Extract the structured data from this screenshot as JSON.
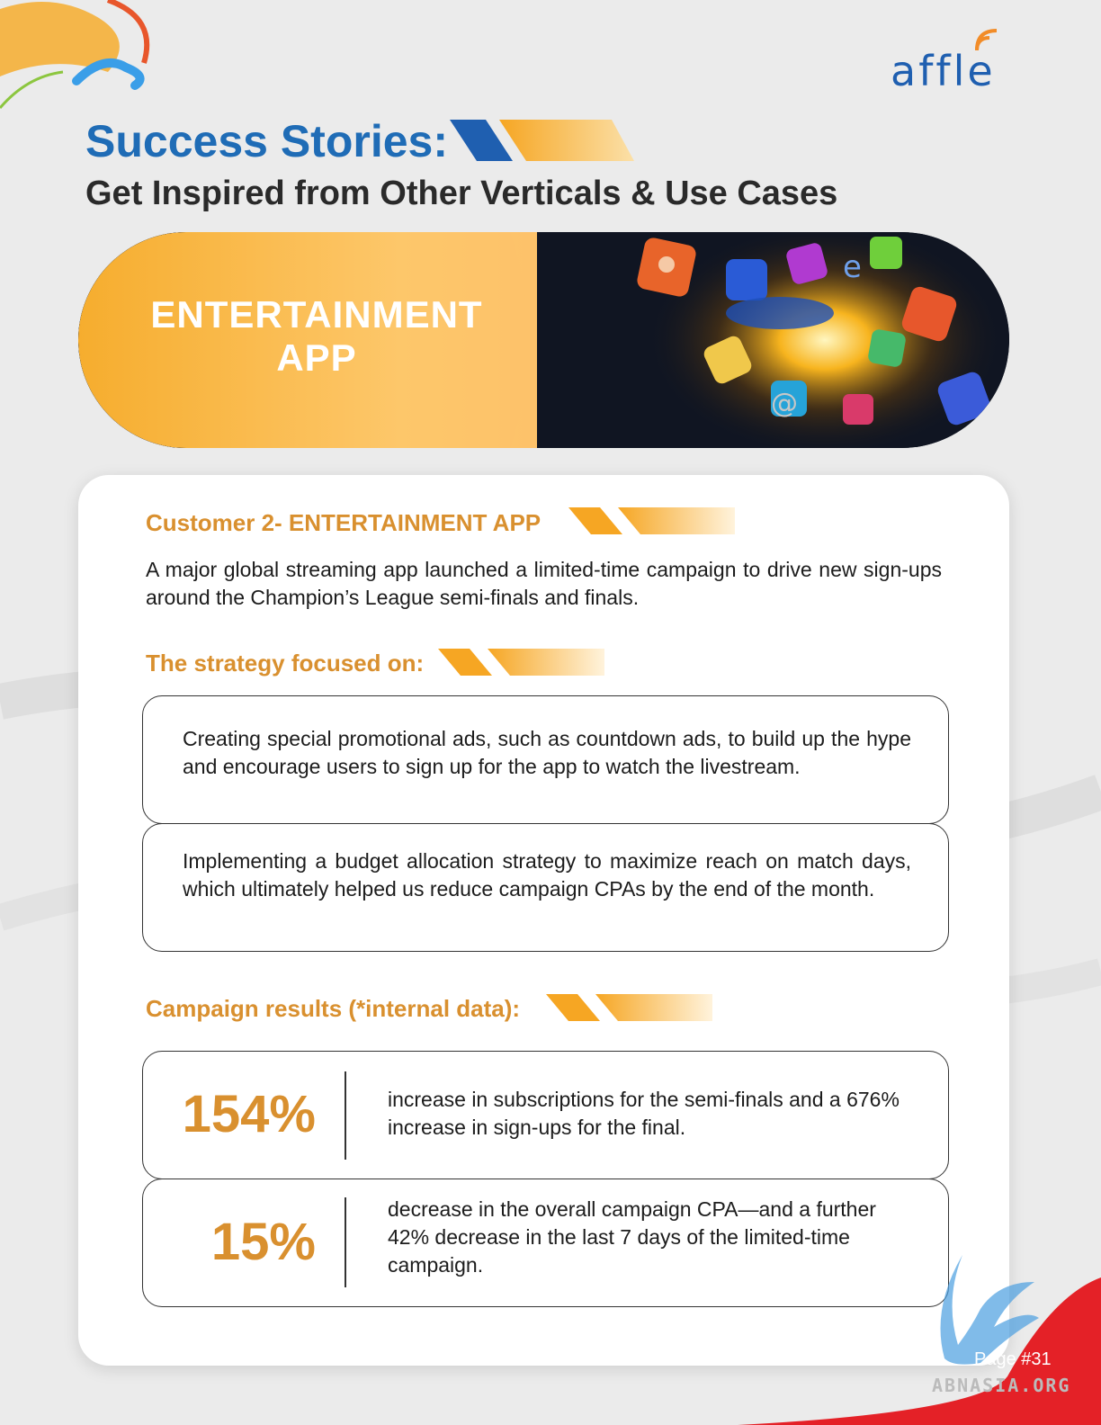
{
  "brand": {
    "logo_text": "affle"
  },
  "header": {
    "title": "Success Stories:",
    "subtitle": "Get Inspired from Other Verticals & Use Cases"
  },
  "hero": {
    "line1": "ENTERTAINMENT",
    "line2": "APP"
  },
  "card": {
    "customer_heading": "Customer 2- ENTERTAINMENT APP",
    "intro": "A major global streaming app launched a limited-time campaign to drive new sign-ups around the Champion’s League semi-finals and finals.",
    "strategy_heading": "The strategy focused on:",
    "strategy_items": [
      "Creating special promotional ads, such as countdown ads, to build up the hype and encourage users to sign up for the app to watch the livestream.",
      "Implementing a budget allocation strategy to maximize reach on match days, which ultimately helped us reduce campaign CPAs by the end of the month."
    ],
    "results_heading": "Campaign results (*internal data):",
    "results": [
      {
        "value": "154%",
        "text": "increase in subscriptions for the semi-finals and a 676% increase in sign-ups for the final."
      },
      {
        "value": "15%",
        "text": "decrease in the overall campaign CPA—and a further 42% decrease in the last 7 days of the limited-time campaign."
      }
    ]
  },
  "footer": {
    "page_label": "Page #31",
    "watermark": "ABNASIA.ORG"
  },
  "colors": {
    "title_blue": "#1f6cb6",
    "accent_orange": "#d9902f",
    "hero_orange": "#f6ad2e",
    "background": "#ebebeb"
  }
}
